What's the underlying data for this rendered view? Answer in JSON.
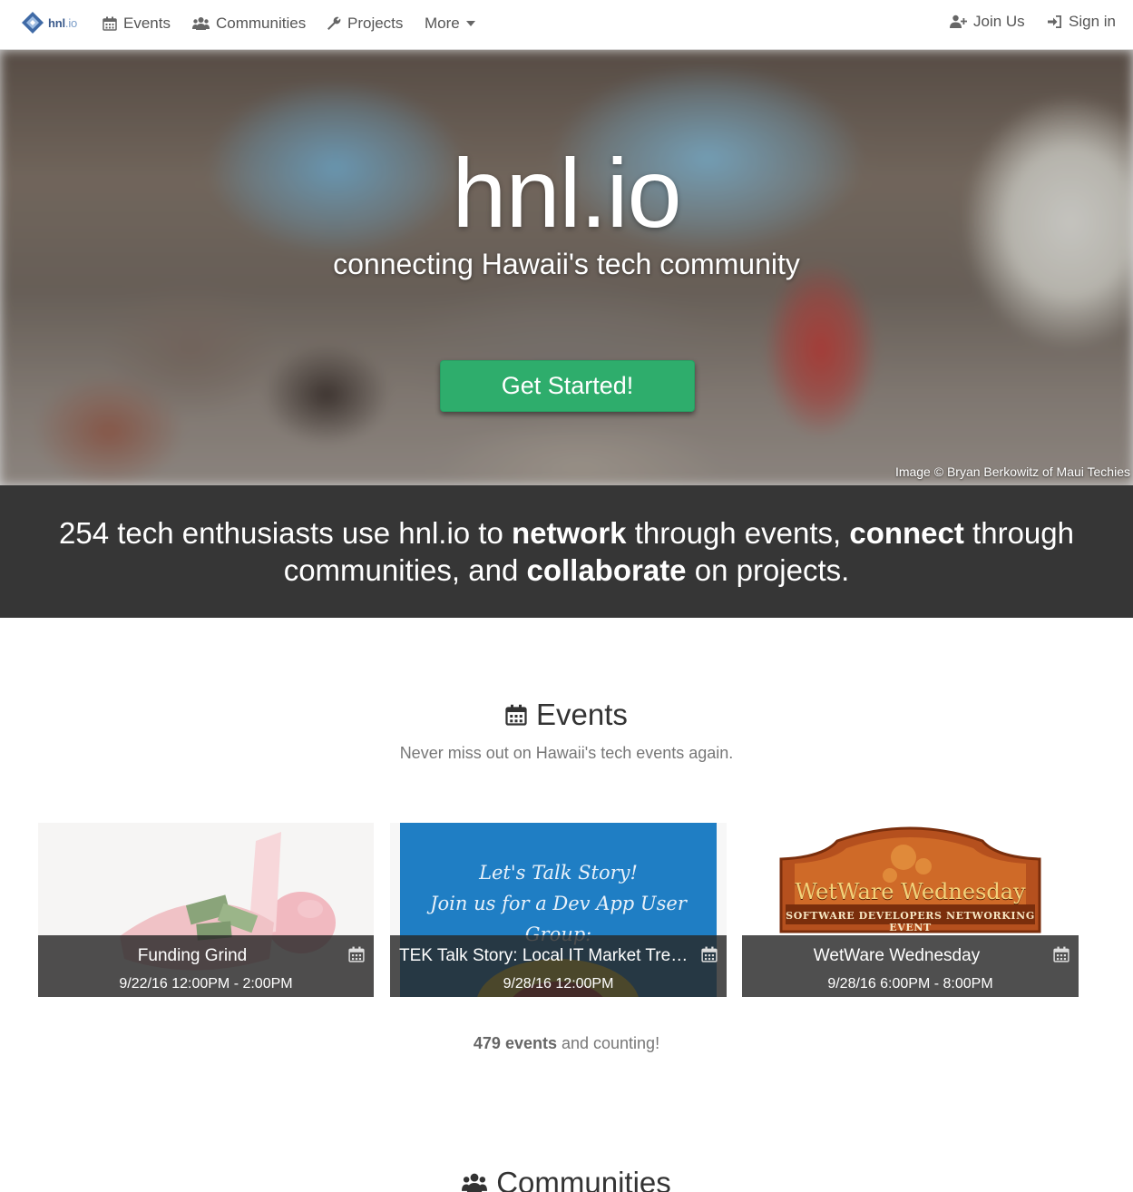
{
  "nav": {
    "brand_bold": "hnl",
    "brand_light": ".io",
    "events": "Events",
    "communities": "Communities",
    "projects": "Projects",
    "more": "More",
    "join": "Join Us",
    "signin": "Sign in"
  },
  "hero": {
    "title": "hnl.io",
    "subtitle": "connecting Hawaii's tech community",
    "cta": "Get Started!",
    "credit": "Image © Bryan Berkowitz of Maui Techies"
  },
  "stats": {
    "line1_a": "254 tech enthusiasts use hnl.io to ",
    "line1_b": "network",
    "line1_c": " through events, ",
    "line1_d": "connect",
    "line1_e": " through",
    "line2_a": "communities, and ",
    "line2_b": "collaborate",
    "line2_c": " on projects."
  },
  "events": {
    "title": "Events",
    "subtitle": "Never miss out on Hawaii's tech events again.",
    "cards": [
      {
        "title": "Funding Grind",
        "date": "9/22/16 12:00PM - 2:00PM"
      },
      {
        "title": "TEK Talk Story: Local IT Market Trends",
        "date": "9/28/16 12:00PM",
        "image_text_1": "Let's Talk Story!",
        "image_text_2": "Join us for a Dev App User Group:"
      },
      {
        "title": "WetWare Wednesday",
        "date": "9/28/16 6:00PM - 8:00PM",
        "logo_text_1": "WetWare Wednesday",
        "logo_text_2": "SOFTWARE DEVELOPERS NETWORKING EVENT"
      }
    ],
    "count": "479 events",
    "count_suffix": " and counting!"
  },
  "communities": {
    "title": "Communities"
  },
  "colors": {
    "accent_green": "#2ead6c",
    "stats_band": "#363636"
  }
}
